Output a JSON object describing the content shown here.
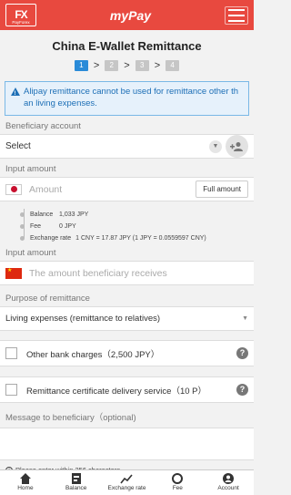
{
  "header": {
    "logo_mark": "FX",
    "logo_text": "PayForex",
    "app_title": "myPay",
    "menu_icon": "hamburger-menu-icon"
  },
  "page": {
    "title": "China E-Wallet Remittance"
  },
  "steps": {
    "items": [
      "1",
      "2",
      "3",
      "4"
    ],
    "active": 1
  },
  "alert": {
    "icon": "warning-icon",
    "text": "Alipay remittance cannot be used for remittance other th",
    "text2": "an living expenses."
  },
  "beneficiary": {
    "label": "Beneficiary account",
    "select_value": "Select",
    "add_icon": "add-person-icon"
  },
  "input_amount": {
    "label": "Input amount",
    "placeholder": "Amount",
    "full_amount_button": "Full amount",
    "balance_key": "Balance",
    "balance_value": "1,033 JPY",
    "fee_key": "Fee",
    "fee_value": "0 JPY",
    "rate_key": "Exchange rate",
    "rate_value": "1 CNY = 17.87 JPY (1 JPY = 0.0559597 CNY)"
  },
  "receive_amount": {
    "label": "Input amount",
    "placeholder": "The amount beneficiary receives"
  },
  "purpose": {
    "label": "Purpose of remittance",
    "value": "Living expenses (remittance to relatives)"
  },
  "options": [
    {
      "label": "Other bank charges（2,500 JPY）"
    },
    {
      "label": "Remittance certificate delivery service（10 P）"
    }
  ],
  "message": {
    "label": "Message to beneficiary（optional)",
    "hint": "Please enter within 256 characters"
  },
  "tabbar": [
    {
      "label": "Home",
      "icon": "home-icon"
    },
    {
      "label": "Balance",
      "icon": "balance-icon"
    },
    {
      "label": "Exchange rate",
      "icon": "chart-icon"
    },
    {
      "label": "Fee",
      "icon": "fee-icon"
    },
    {
      "label": "Account",
      "icon": "account-icon"
    }
  ],
  "colors": {
    "brand": "#e8493f",
    "accent": "#2a8bd8",
    "alert_bg": "#e6f1fb"
  }
}
